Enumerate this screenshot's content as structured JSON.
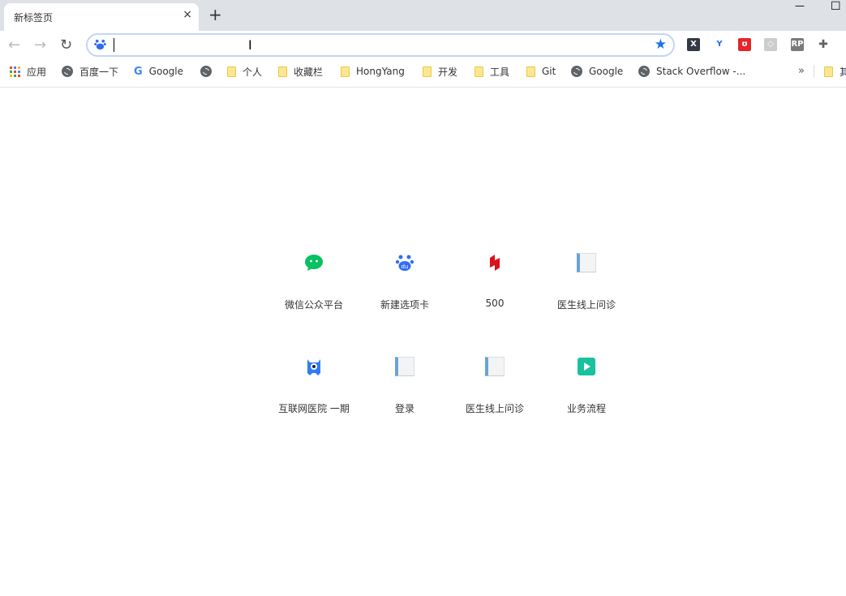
{
  "tab": {
    "title": "新标签页",
    "close": "×",
    "new_tab": "+"
  },
  "window": {
    "minimize": "—",
    "maximize": "☐"
  },
  "toolbar": {
    "back": "←",
    "forward": "→",
    "reload": "↻",
    "omnibox_value": "",
    "star": "★"
  },
  "extensions": [
    {
      "name": "x-ext",
      "glyph": "X",
      "color": "#333a45"
    },
    {
      "name": "y-ext",
      "glyph": "Y",
      "color": "#1e6ee8"
    },
    {
      "name": "red-ext",
      "glyph": "ʊ",
      "color": "#e4262b"
    },
    {
      "name": "gray-ext",
      "glyph": "◇",
      "color": "#cccccc"
    },
    {
      "name": "rp-ext",
      "glyph": "RP",
      "color": "#7a7a7a"
    },
    {
      "name": "puzzle-ext",
      "glyph": "✚",
      "color": "#5f6368"
    }
  ],
  "bookmarks": [
    {
      "label": "应用",
      "icon": "apps"
    },
    {
      "label": "百度一下",
      "icon": "globe"
    },
    {
      "label": "Google",
      "icon": "google"
    },
    {
      "label": "",
      "icon": "globe"
    },
    {
      "label": "个人",
      "icon": "folder"
    },
    {
      "label": "收藏栏",
      "icon": "folder"
    },
    {
      "label": "HongYang",
      "icon": "folder"
    },
    {
      "label": "开发",
      "icon": "folder"
    },
    {
      "label": "工具",
      "icon": "folder"
    },
    {
      "label": "Git",
      "icon": "folder"
    },
    {
      "label": "Google",
      "icon": "globe"
    },
    {
      "label": "Stack Overflow -...",
      "icon": "globe"
    },
    {
      "label": "其",
      "icon": "folder"
    }
  ],
  "overflow": "»",
  "shortcuts": [
    {
      "label": "微信公众平台",
      "icon": "wechat"
    },
    {
      "label": "新建选项卡",
      "icon": "baidu"
    },
    {
      "label": "500",
      "icon": "red-logo"
    },
    {
      "label": "医生线上问诊",
      "icon": "doc"
    },
    {
      "label": "互联网医院 一期",
      "icon": "monster"
    },
    {
      "label": "登录",
      "icon": "doc"
    },
    {
      "label": "医生线上问诊",
      "icon": "doc"
    },
    {
      "label": "业务流程",
      "icon": "play"
    }
  ]
}
